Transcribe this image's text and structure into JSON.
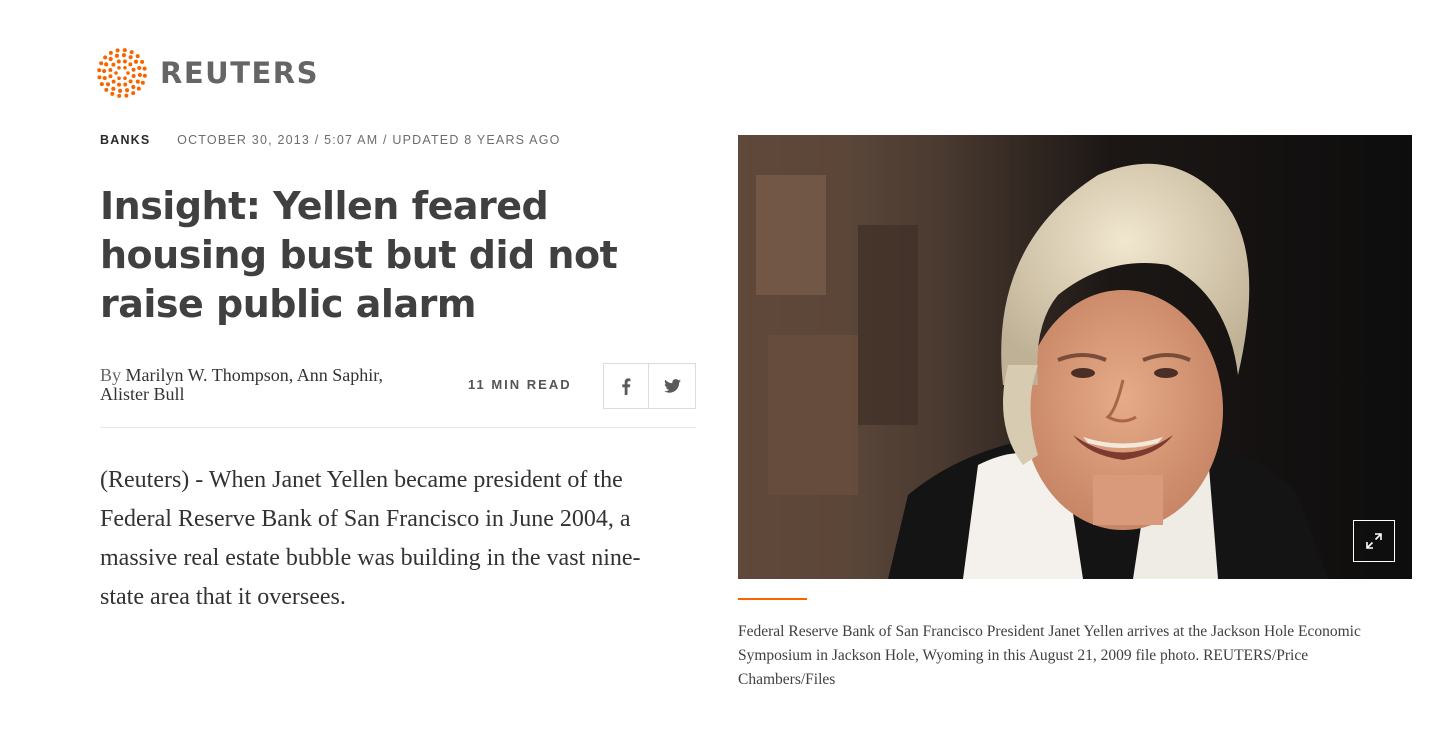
{
  "brand": {
    "name": "REUTERS",
    "logo_icon": "reuters-dot-sphere-icon",
    "accent_color": "#fa6400"
  },
  "article": {
    "section": "BANKS",
    "dateline": "OCTOBER 30, 2013 / 5:07 AM / UPDATED 8 YEARS AGO",
    "headline": "Insight: Yellen feared housing bust but did not raise public alarm",
    "byline_prefix": "By",
    "authors": "Marilyn W. Thompson, Ann Saphir, Alister Bull",
    "read_time": "11 MIN READ",
    "share": {
      "facebook_icon": "facebook-icon",
      "twitter_icon": "twitter-icon"
    },
    "body": "(Reuters) - When Janet Yellen became president of the Federal Reserve Bank of San Francisco in June 2004, a massive real estate bubble was building in the vast nine-state area that it oversees."
  },
  "photo": {
    "expand_icon": "expand-icon",
    "caption": "Federal Reserve Bank of San Francisco President Janet Yellen arrives at the Jackson Hole Economic Symposium in Jackson Hole, Wyoming in this August 21, 2009 file photo. REUTERS/Price Chambers/Files"
  }
}
